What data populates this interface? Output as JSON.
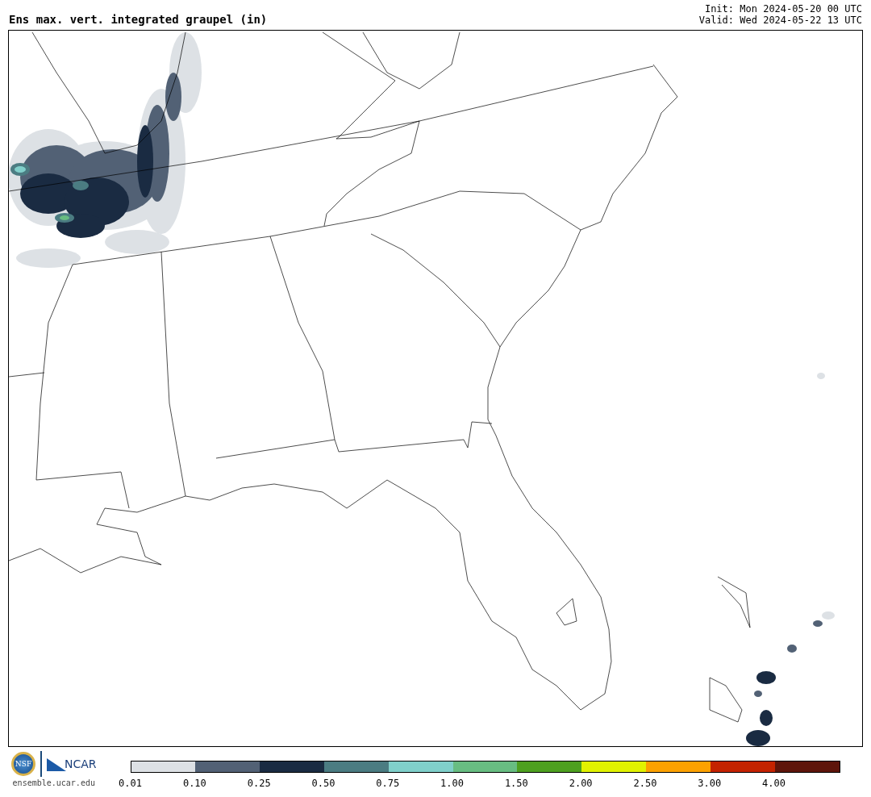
{
  "title": "Ens max. vert. integrated graupel (in)",
  "init": "Init: Mon 2024-05-20 00 UTC",
  "valid": "Valid: Wed 2024-05-22 13 UTC",
  "logos": {
    "nsf": "NSF",
    "ncar": "NCAR"
  },
  "site": "ensemble.ucar.edu",
  "colorbar": {
    "bins": [
      {
        "color": "#dde1e5"
      },
      {
        "color": "#526175"
      },
      {
        "color": "#1a2b42"
      },
      {
        "color": "#4b7c82"
      },
      {
        "color": "#80cfca"
      },
      {
        "color": "#68bd82"
      },
      {
        "color": "#4ea020"
      },
      {
        "color": "#e1f200"
      },
      {
        "color": "#fca100"
      },
      {
        "color": "#c42300"
      },
      {
        "color": "#5e150b"
      }
    ],
    "ticks": [
      "0.01",
      "0.10",
      "0.25",
      "0.50",
      "0.75",
      "1.00",
      "1.50",
      "2.00",
      "2.50",
      "3.00",
      "4.00"
    ]
  }
}
